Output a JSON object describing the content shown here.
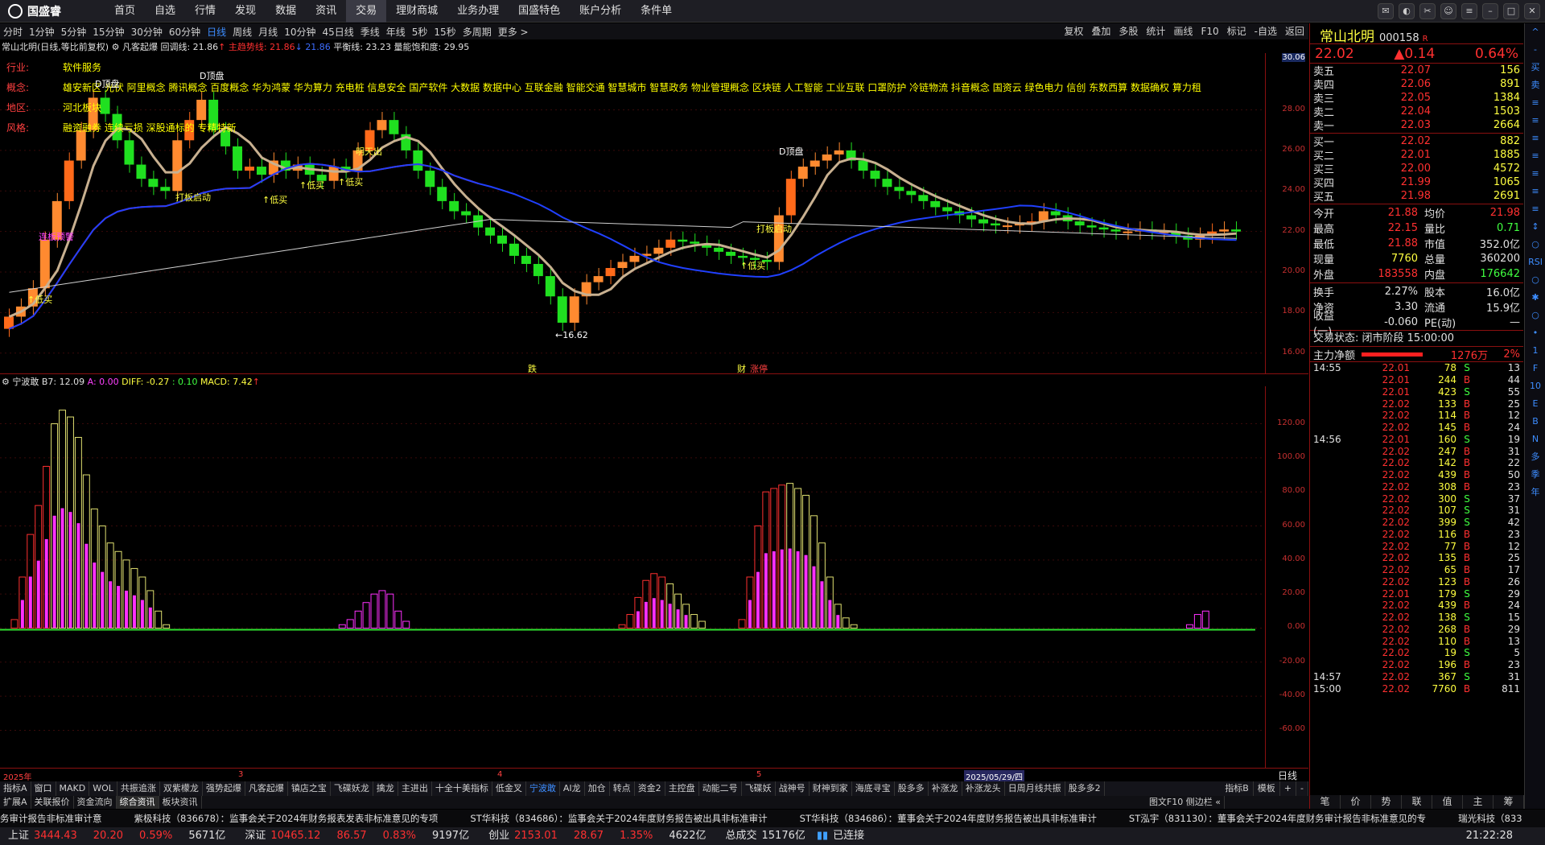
{
  "app": {
    "logo_text": "国盛睿",
    "menu": [
      "首页",
      "自选",
      "行情",
      "发现",
      "数据",
      "资讯",
      "交易",
      "理财商城",
      "业务办理",
      "国盛特色",
      "账户分析",
      "条件单"
    ]
  },
  "periods": [
    "分时",
    "1分钟",
    "5分钟",
    "15分钟",
    "30分钟",
    "60分钟",
    "日线",
    "周线",
    "月线",
    "10分钟",
    "45日线",
    "季线",
    "年线",
    "5秒",
    "15秒",
    "多周期",
    "更多 >"
  ],
  "period_active": "日线",
  "period_tools": [
    "复权",
    "叠加",
    "多股",
    "统计",
    "画线",
    "F10",
    "标记",
    "-自选",
    "返回"
  ],
  "kline_title": {
    "stock": "常山北明(日线,等比前复权)",
    "indicator": "凡客起爆",
    "huitiao": "回调线: 21.86",
    "zhuli": "主趋势线: 21.86",
    "third": "21.86",
    "pingheng": "平衡线: 23.23",
    "liangneng": "量能饱和度: 29.95"
  },
  "info_panel": [
    {
      "k": "行业:",
      "v": "软件服务"
    },
    {
      "k": "概念:",
      "v": "雄安新区 光伏 阿里概念 腾讯概念 百度概念 华为鸿蒙 华为算力 充电桩 信息安全 国产软件 大数据 数据中心 互联金融 智能交通 智慧城市 智慧政务 物业管理概念 区块链 人工智能 工业互联 口罩防护 冷链物流 抖音概念 国资云 绿色电力 信创 东数西算 数据确权 算力租"
    },
    {
      "k": "地区:",
      "v": "河北板块"
    },
    {
      "k": "风格:",
      "v": "融资融券 连续亏损 深股通标的 专精特新"
    }
  ],
  "annotations": {
    "low_buy": "↑低买",
    "breakout": "打板启动",
    "ming_tian_chu": "明天出",
    "low_price": "←16.62",
    "d_top": "D顶盘",
    "lianban": "连板预警",
    "die": "跌",
    "cai": "财",
    "zhangting": "涨停"
  },
  "price_axis": [
    "30.06",
    "28.00",
    "26.00",
    "24.00",
    "22.00",
    "20.00",
    "18.00",
    "16.00"
  ],
  "ind_title": {
    "name": "宁波敢",
    "b7": "B7: 12.09",
    "a": "A: 0.00",
    "diff": "DIFF: -0.27",
    "dot": ": 0.10",
    "macd": "MACD: 7.42"
  },
  "ind_axis": [
    "120.00",
    "100.00",
    "80.00",
    "60.00",
    "40.00",
    "20.00",
    "0.00",
    "-20.00",
    "-40.00",
    "-60.00"
  ],
  "date_axis": {
    "d1": "2025年",
    "d2": "3",
    "d3": "4",
    "d4": "5",
    "range": "2025/05/29/四",
    "period": "日线"
  },
  "ind_tabs": [
    "指标A",
    "窗口",
    "MAKD",
    "WOL",
    "共振追涨",
    "双紫檬龙",
    "强势起爆",
    "凡客起爆",
    "镇店之宝",
    "飞碟妖龙",
    "擒龙",
    "主进出",
    "十全十美指标",
    "低金叉",
    "宁波敢",
    "AI龙",
    "加仓",
    "转点",
    "资金2",
    "主控盘",
    "动能二号",
    "飞碟妖",
    "战神号",
    "财神到家",
    "海底寻宝",
    "股多多",
    "补涨龙",
    "补涨龙头",
    "日周月线共振",
    "股多多2"
  ],
  "ind_tab_active": "宁波敢",
  "ind_tabs_right": [
    "指标B",
    "模板",
    "+",
    "-"
  ],
  "sub_tabs": [
    "扩展A",
    "关联报价",
    "资金流向",
    "综合资讯",
    "板块资讯"
  ],
  "sub_tab_active": "综合资讯",
  "sub_tabs_right": "图文F10 侧边栏 «",
  "news": [
    "务审计报告非标准审计意",
    "紫极科技（836678）：监事会关于2024年财务报表发表非标准意见的专项",
    "ST华科技（834686）：监事会关于2024年度财务报告被出具非标准审计",
    "ST华科技（834686）：董事会关于2024年度财务报告被出具非标准审计",
    "ST泓宇（831130）：董事会关于2024年度财务审计报告非标准意见的专",
    "瑞光科技（833"
  ],
  "status": {
    "sh_label": "上证",
    "sh_val": "3444.43",
    "sh_chg": "20.20",
    "sh_pct": "0.59%",
    "sh_amt": "5671亿",
    "sz_label": "深证",
    "sz_val": "10465.12",
    "sz_chg": "86.57",
    "sz_pct": "0.83%",
    "sz_amt": "9197亿",
    "cy_label": "创业",
    "cy_val": "2153.01",
    "cy_chg": "28.67",
    "cy_pct": "1.35%",
    "cy_amt": "4622亿",
    "total_label": "总成交",
    "total_val": "15176亿",
    "conn": "已连接",
    "clock": "21:22:28"
  },
  "quote": {
    "name": "常山北明",
    "code": "000158",
    "flag": "R",
    "price": "22.02",
    "change": "▲0.14",
    "pct": "0.64%",
    "asks": [
      {
        "l": "卖五",
        "p": "22.07",
        "v": "156"
      },
      {
        "l": "卖四",
        "p": "22.06",
        "v": "891"
      },
      {
        "l": "卖三",
        "p": "22.05",
        "v": "1384"
      },
      {
        "l": "卖二",
        "p": "22.04",
        "v": "1503"
      },
      {
        "l": "卖一",
        "p": "22.03",
        "v": "2664"
      }
    ],
    "bids": [
      {
        "l": "买一",
        "p": "22.02",
        "v": "882"
      },
      {
        "l": "买二",
        "p": "22.01",
        "v": "1885"
      },
      {
        "l": "买三",
        "p": "22.00",
        "v": "4572"
      },
      {
        "l": "买四",
        "p": "21.99",
        "v": "1065"
      },
      {
        "l": "买五",
        "p": "21.98",
        "v": "2691"
      }
    ],
    "stats": [
      {
        "l1": "今开",
        "v1": "21.88",
        "l2": "均价",
        "v2": "21.98"
      },
      {
        "l1": "最高",
        "v1": "22.15",
        "l2": "量比",
        "v2": "0.71"
      },
      {
        "l1": "最低",
        "v1": "21.88",
        "l2": "市值",
        "v2": "352.0亿"
      },
      {
        "l1": "现量",
        "v1": "7760",
        "l2": "总量",
        "v2": "360200"
      },
      {
        "l1": "外盘",
        "v1": "183558",
        "l2": "内盘",
        "v2": "176642"
      }
    ],
    "stats2": [
      {
        "l1": "换手",
        "v1": "2.27%",
        "l2": "股本",
        "v2": "16.0亿"
      },
      {
        "l1": "净资",
        "v1": "3.30",
        "l2": "流通",
        "v2": "15.9亿"
      },
      {
        "l1": "收益(一)",
        "v1": "-0.060",
        "l2": "PE(动)",
        "v2": "—"
      }
    ],
    "trade_state": "交易状态: 闭市阶段 15:00:00",
    "main_net_label": "主力净额",
    "main_net_val": "1276万",
    "main_net_pct": "2%",
    "ticks": [
      {
        "t": "14:55",
        "p": "22.01",
        "v": "78",
        "s": "S",
        "c": "13"
      },
      {
        "t": "",
        "p": "22.01",
        "v": "244",
        "s": "B",
        "c": "44"
      },
      {
        "t": "",
        "p": "22.01",
        "v": "423",
        "s": "S",
        "c": "55"
      },
      {
        "t": "",
        "p": "22.02",
        "v": "133",
        "s": "B",
        "c": "25"
      },
      {
        "t": "",
        "p": "22.02",
        "v": "114",
        "s": "B",
        "c": "12"
      },
      {
        "t": "",
        "p": "22.02",
        "v": "145",
        "s": "B",
        "c": "24"
      },
      {
        "t": "14:56",
        "p": "22.01",
        "v": "160",
        "s": "S",
        "c": "19"
      },
      {
        "t": "",
        "p": "22.02",
        "v": "247",
        "s": "B",
        "c": "31"
      },
      {
        "t": "",
        "p": "22.02",
        "v": "142",
        "s": "B",
        "c": "22"
      },
      {
        "t": "",
        "p": "22.02",
        "v": "439",
        "s": "B",
        "c": "50"
      },
      {
        "t": "",
        "p": "22.02",
        "v": "308",
        "s": "B",
        "c": "23"
      },
      {
        "t": "",
        "p": "22.02",
        "v": "300",
        "s": "S",
        "c": "37"
      },
      {
        "t": "",
        "p": "22.02",
        "v": "107",
        "s": "S",
        "c": "31"
      },
      {
        "t": "",
        "p": "22.02",
        "v": "399",
        "s": "S",
        "c": "42"
      },
      {
        "t": "",
        "p": "22.02",
        "v": "116",
        "s": "B",
        "c": "23"
      },
      {
        "t": "",
        "p": "22.02",
        "v": "77",
        "s": "B",
        "c": "12"
      },
      {
        "t": "",
        "p": "22.02",
        "v": "135",
        "s": "B",
        "c": "25"
      },
      {
        "t": "",
        "p": "22.02",
        "v": "65",
        "s": "B",
        "c": "17"
      },
      {
        "t": "",
        "p": "22.02",
        "v": "123",
        "s": "B",
        "c": "26"
      },
      {
        "t": "",
        "p": "22.01",
        "v": "179",
        "s": "S",
        "c": "29"
      },
      {
        "t": "",
        "p": "22.02",
        "v": "439",
        "s": "B",
        "c": "24"
      },
      {
        "t": "",
        "p": "22.02",
        "v": "138",
        "s": "S",
        "c": "15"
      },
      {
        "t": "",
        "p": "22.02",
        "v": "268",
        "s": "B",
        "c": "29"
      },
      {
        "t": "",
        "p": "22.02",
        "v": "110",
        "s": "B",
        "c": "13"
      },
      {
        "t": "",
        "p": "22.02",
        "v": "19",
        "s": "S",
        "c": "5"
      },
      {
        "t": "",
        "p": "22.02",
        "v": "196",
        "s": "B",
        "c": "23"
      },
      {
        "t": "14:57",
        "p": "22.02",
        "v": "367",
        "s": "S",
        "c": "31"
      },
      {
        "t": "15:00",
        "p": "22.02",
        "v": "7760",
        "s": "B",
        "c": "811"
      }
    ],
    "bottom_tabs": [
      "笔",
      "价",
      "势",
      "联",
      "值",
      "主",
      "筹"
    ]
  },
  "right_strip": [
    "^",
    "-",
    "买",
    "卖",
    "≡",
    "≡",
    "≡",
    "≡",
    "≡",
    "≡",
    "≡",
    "↕",
    "○",
    "RSI",
    "○",
    "✱",
    "○",
    "•",
    "1",
    "F",
    "10",
    "E",
    "B",
    "N",
    "多",
    "季",
    "年"
  ],
  "colors": {
    "up": "#ff3030",
    "down": "#40ff40",
    "bg": "#000000",
    "grid": "#8b1010",
    "yellow": "#ffff40",
    "magenta": "#ff40ff"
  }
}
